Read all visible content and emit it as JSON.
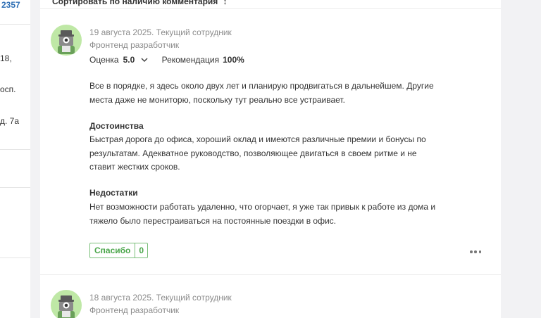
{
  "sidebar": {
    "count": "2357",
    "lines": [
      "18,",
      "осп.",
      "д. 7а"
    ]
  },
  "sort_bar": {
    "label": "Сортировать по наличию комментария",
    "arrow": "↕"
  },
  "reviews": [
    {
      "meta": "19 августа 2025. Текущий сотрудник",
      "position": "Фронтенд разработчик",
      "rating_label": "Оценка",
      "rating_value": "5.0",
      "recommend_label": "Рекомендация",
      "recommend_value": "100%",
      "intro": "Все в порядке, я здесь около двух лет и планирую продвигаться в дальнейшем. Другие места даже не мониторю, поскольку тут реально все устраивает.",
      "pros_title": "Достоинства",
      "pros_text": "Быстрая дорога до офиса, хороший оклад и имеются различные премии и бонусы по результатам. Адекватное руководство, позволяющее двигаться в своем ритме и не ставит жестких сроков.",
      "cons_title": "Недостатки",
      "cons_text": "Нет возможности работать удаленно, что огорчает, я уже так привык к работе из дома и тяжело было перестраиваться на постоянные поездки в офис.",
      "thanks_label": "Спасибо",
      "thanks_count": "0",
      "avatar_icon": "avatar-robot-icon"
    },
    {
      "meta": "18 августа 2025. Текущий сотрудник",
      "position": "Фронтенд разработчик",
      "avatar_icon": "avatar-robot-icon"
    }
  ],
  "colors": {
    "accent_green": "#4aa64a",
    "avatar_bg": "#bfe8a6",
    "link_blue": "#2f6fb5"
  }
}
